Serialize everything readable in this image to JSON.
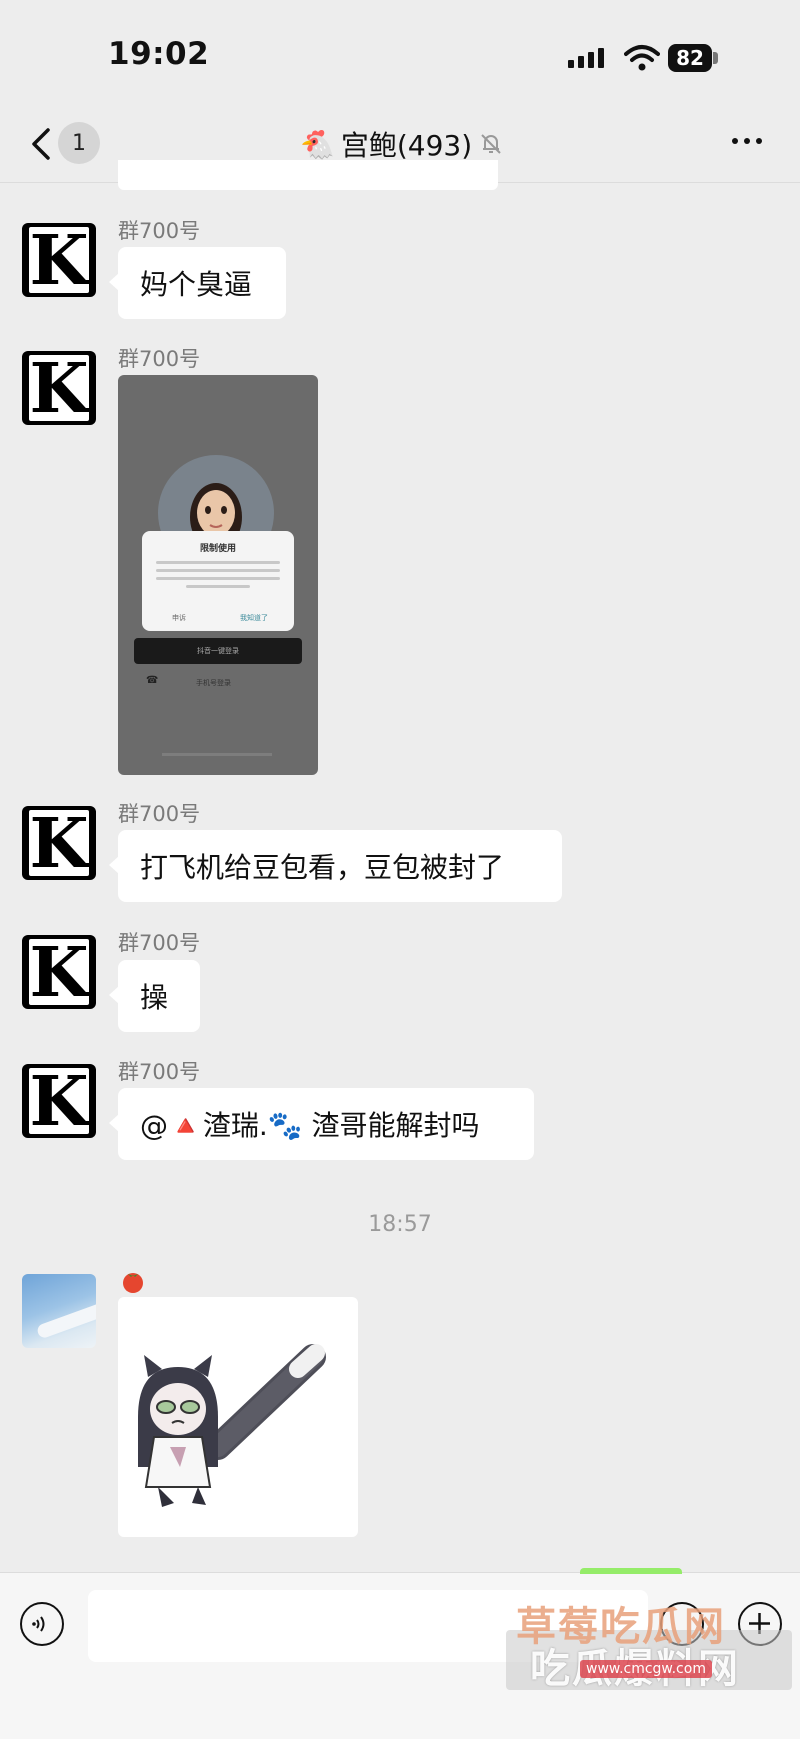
{
  "status_bar": {
    "time": "19:02",
    "battery": "82"
  },
  "nav": {
    "back_count": "1",
    "title": "宫鲍(493)",
    "title_emoji": "🐔"
  },
  "avatar_letter": "K",
  "messages": [
    {
      "sender": "群700号",
      "text": "妈个臭逼"
    },
    {
      "sender": "群700号",
      "image": {
        "dialog_title": "限制使用",
        "cancel": "申诉",
        "ok": "我知道了",
        "login": "抖音一键登录",
        "phone_login": "手机号登录"
      }
    },
    {
      "sender": "群700号",
      "text": "打飞机给豆包看，豆包被封了"
    },
    {
      "sender": "群700号",
      "text": "操"
    },
    {
      "sender": "群700号",
      "text": "@🔺渣瑞.🐾 渣哥能解封吗"
    }
  ],
  "timestamp": "18:57",
  "sticker_sender_icon": "tomato-icon",
  "watermark": {
    "line1": "草莓吃瓜网",
    "line2": "吃瓜爆料网",
    "url": "www.cmcgw.com"
  },
  "colors": {
    "background": "#ededed",
    "bubble": "#ffffff",
    "self_bubble": "#95ec69"
  }
}
